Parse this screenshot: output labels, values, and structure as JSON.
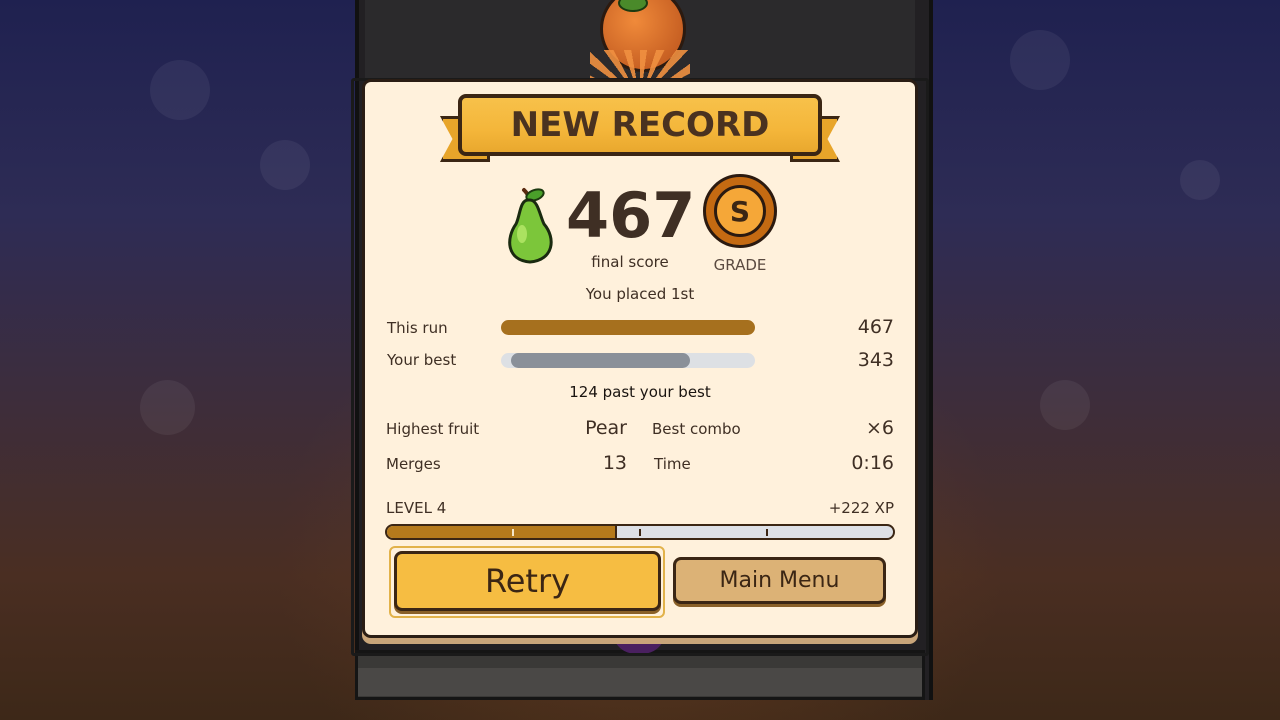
{
  "banner": {
    "title": "NEW RECORD"
  },
  "result": {
    "fruit_icon": "pear-icon",
    "score": "467",
    "score_label": "final score",
    "grade": "S",
    "grade_label": "GRADE",
    "placement": "You placed 1st"
  },
  "comparison": {
    "this_run": {
      "label": "This run",
      "value": "467",
      "fraction": 1.0
    },
    "your_best": {
      "label": "Your best",
      "value": "343",
      "fraction": 0.734
    },
    "difference_text": "124 past your best"
  },
  "stats": {
    "highest_fruit": {
      "label": "Highest fruit",
      "value": "Pear"
    },
    "best_combo": {
      "label": "Best combo",
      "value": "×6"
    },
    "merges": {
      "label": "Merges",
      "value": "13"
    },
    "time": {
      "label": "Time",
      "value": "0:16"
    }
  },
  "progress": {
    "level": "LEVEL 4",
    "xp_gain": "+222 XP",
    "fill_fraction": 0.45
  },
  "buttons": {
    "retry": "Retry",
    "main_menu": "Main Menu"
  },
  "colors": {
    "accent": "#f6bd42",
    "this_run_bar": "#a6701e",
    "best_bar": "#8a9099",
    "panel": "#fff1dc"
  }
}
